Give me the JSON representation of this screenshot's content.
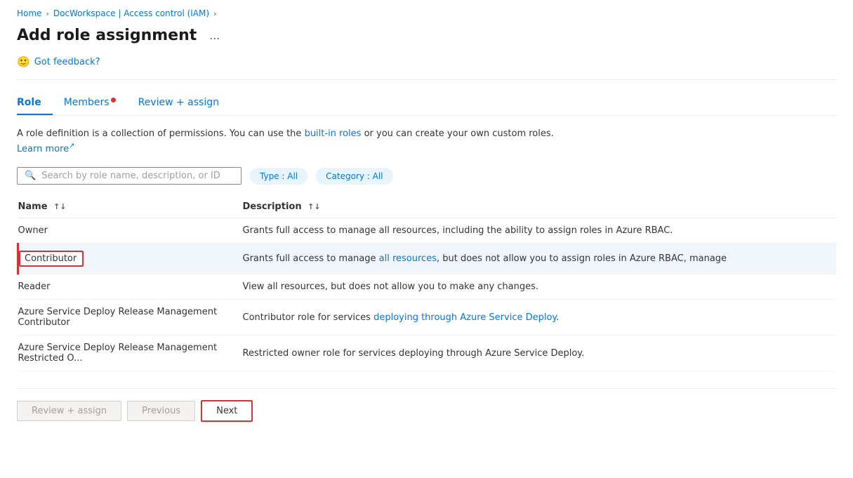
{
  "breadcrumb": {
    "home": "Home",
    "workspace": "DocWorkspace | Access control (IAM)"
  },
  "page": {
    "title": "Add role assignment",
    "ellipsis": "..."
  },
  "feedback": {
    "label": "Got feedback?"
  },
  "tabs": [
    {
      "id": "role",
      "label": "Role",
      "active": true,
      "has_dot": false
    },
    {
      "id": "members",
      "label": "Members",
      "active": false,
      "has_dot": true
    },
    {
      "id": "review",
      "label": "Review + assign",
      "active": false,
      "has_dot": false
    }
  ],
  "description": {
    "text1": "A role definition is a collection of permissions. You can use the ",
    "link1": "built-in roles",
    "text2": " or you can create your own custom roles. ",
    "link2": "Learn more",
    "link2_icon": "↗"
  },
  "search": {
    "placeholder": "Search by role name, description, or ID"
  },
  "filters": [
    {
      "id": "type",
      "label": "Type : All"
    },
    {
      "id": "category",
      "label": "Category : All"
    }
  ],
  "table": {
    "headers": [
      {
        "id": "name",
        "label": "Name",
        "sort": "↑↓"
      },
      {
        "id": "description",
        "label": "Description",
        "sort": "↑↓"
      }
    ],
    "rows": [
      {
        "id": "owner",
        "name": "Owner",
        "description": "Grants full access to manage all resources, including the ability to assign roles in Azure RBAC.",
        "desc_link": "",
        "selected": false
      },
      {
        "id": "contributor",
        "name": "Contributor",
        "description_pre": "Grants full access to manage ",
        "description_link": "all resources",
        "description_post": ", but does not allow you to assign roles in Azure RBAC, manage",
        "selected": true
      },
      {
        "id": "reader",
        "name": "Reader",
        "description_pre": "View all resources, but does not allow you to make any changes.",
        "description_link": "",
        "description_post": "",
        "selected": false
      },
      {
        "id": "azure-deploy-contributor",
        "name": "Azure Service Deploy Release Management Contributor",
        "description_pre": "Contributor role for services ",
        "description_link": "deploying through Azure Service Deploy",
        "description_post": ".",
        "selected": false
      },
      {
        "id": "azure-deploy-restricted",
        "name": "Azure Service Deploy Release Management Restricted O...",
        "description_pre": "Restricted owner role for services deploying through Azure Service Deploy.",
        "description_link": "",
        "description_post": "",
        "selected": false
      }
    ]
  },
  "footer": {
    "review_assign_label": "Review + assign",
    "previous_label": "Previous",
    "next_label": "Next"
  }
}
